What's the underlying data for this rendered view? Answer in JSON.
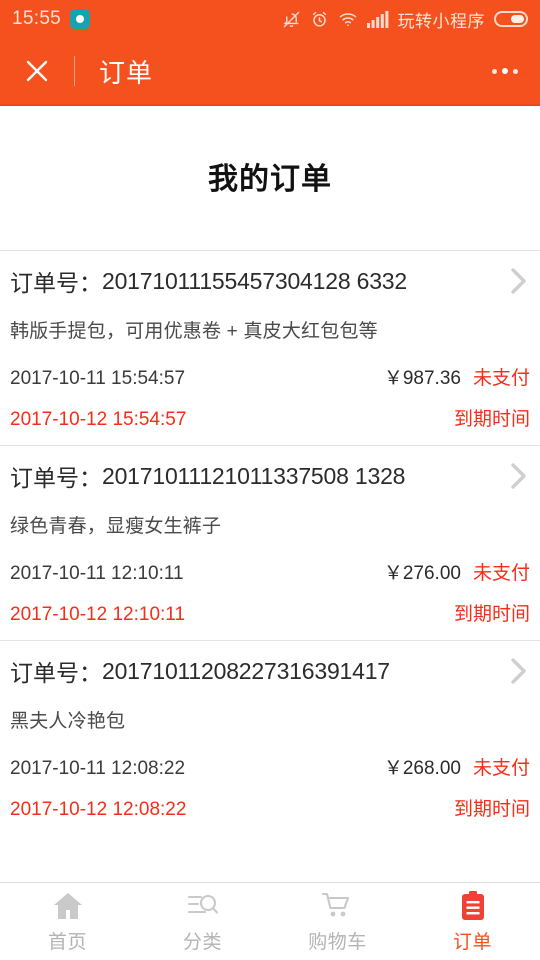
{
  "statusbar": {
    "time": "15:55",
    "app_icon": "camera-app-icon",
    "icons": [
      "bell-muted-icon",
      "alarm-clock-icon",
      "wifi-icon",
      "signal-bars-icon"
    ],
    "carrier": "玩转小程序",
    "battery_icon": "battery-icon"
  },
  "navbar": {
    "close_icon": "close-icon",
    "title": "订单",
    "more_icon": "more-options-icon"
  },
  "page": {
    "title": "我的订单",
    "order_no_label": "订单号：",
    "expiry_label": "到期时间",
    "currency": "￥",
    "accent_color": "#f4511e",
    "status_color": "#f82c18"
  },
  "orders": [
    {
      "order_no": "20171011155457304128 6332",
      "description": "韩版手提包，可用优惠卷 + 真皮大红包包等",
      "created_at": "2017-10-11 15:54:57",
      "price": "￥987.36",
      "status": "未支付",
      "expires_at": "2017-10-12 15:54:57",
      "expiry_label": "到期时间"
    },
    {
      "order_no": "20171011121011337508 1328",
      "description": "绿色青春，显瘦女生裤子",
      "created_at": "2017-10-11 12:10:11",
      "price": "￥276.00",
      "status": "未支付",
      "expires_at": "2017-10-12 12:10:11",
      "expiry_label": "到期时间"
    },
    {
      "order_no": "20171011208227316391417",
      "description": "黑夫人冷艳包",
      "created_at": "2017-10-11 12:08:22",
      "price": "￥268.00",
      "status": "未支付",
      "expires_at": "2017-10-12 12:08:22",
      "expiry_label": "到期时间"
    }
  ],
  "tabbar": {
    "items": [
      {
        "label": "首页",
        "icon": "home-icon",
        "active": false
      },
      {
        "label": "分类",
        "icon": "category-search-icon",
        "active": false
      },
      {
        "label": "购物车",
        "icon": "shopping-cart-icon",
        "active": false
      },
      {
        "label": "订单",
        "icon": "clipboard-order-icon",
        "active": true
      }
    ]
  }
}
